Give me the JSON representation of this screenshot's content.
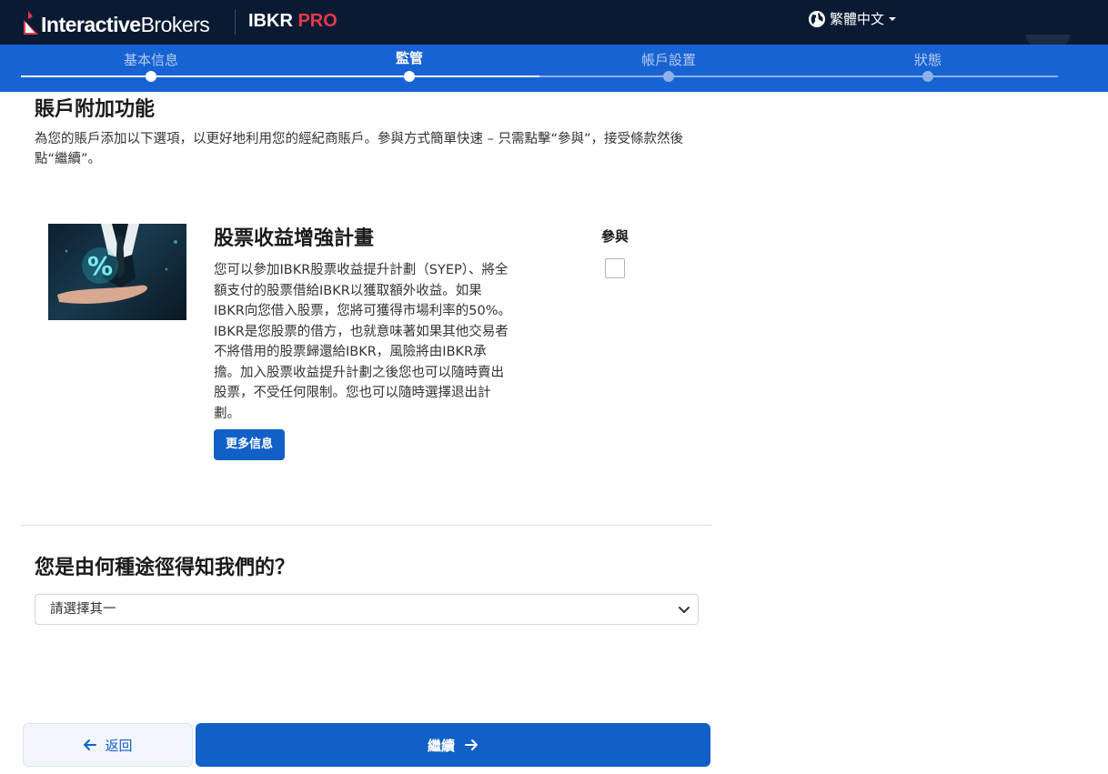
{
  "header": {
    "brand_bold": "Interactive",
    "brand_light": "Brokers",
    "product_main": "IBKR",
    "product_accent": "PRO",
    "language": "繁體中文",
    "globe_icon": "globe-icon",
    "caret_icon": "caret-down-icon"
  },
  "steps": [
    {
      "label": "基本信息",
      "state": "done"
    },
    {
      "label": "監管",
      "state": "active"
    },
    {
      "label": "帳戶設置",
      "state": "todo"
    },
    {
      "label": "狀態",
      "state": "todo"
    }
  ],
  "addons": {
    "title": "賬戶附加功能",
    "description": "為您的賬戶添加以下選項，以更好地利用您的經紀商賬戶。參與方式簡單快速 – 只需點擊“參與”，接受條款然後點“繼續”。"
  },
  "feature": {
    "title": "股票收益增強計畫",
    "body": "您可以參加IBKR股票收益提升計劃（SYEP）、將全額支付的股票借給IBKR以獲取額外收益。如果IBKR向您借入股票，您將可獲得市場利率的50%。IBKR是您股票的借方，也就意味著如果其他交易者不將借用的股票歸還給IBKR，風險將由IBKR承擔。加入股票收益提升計劃之後您也可以隨時賣出股票，不受任何限制。您也可以隨時選擇退出計劃。",
    "more_button": "更多信息",
    "participate_label": "參與",
    "participate_checked": false,
    "image_text": "%"
  },
  "referral": {
    "question": "您是由何種途徑得知我們的？",
    "select_value": "請選擇其一"
  },
  "footer": {
    "back_label": "返回",
    "next_label": "繼續"
  },
  "colors": {
    "topbar": "#0b1a33",
    "stepper": "#1763d3",
    "primary_button": "#1160c8",
    "brand_red": "#e33b4b"
  }
}
